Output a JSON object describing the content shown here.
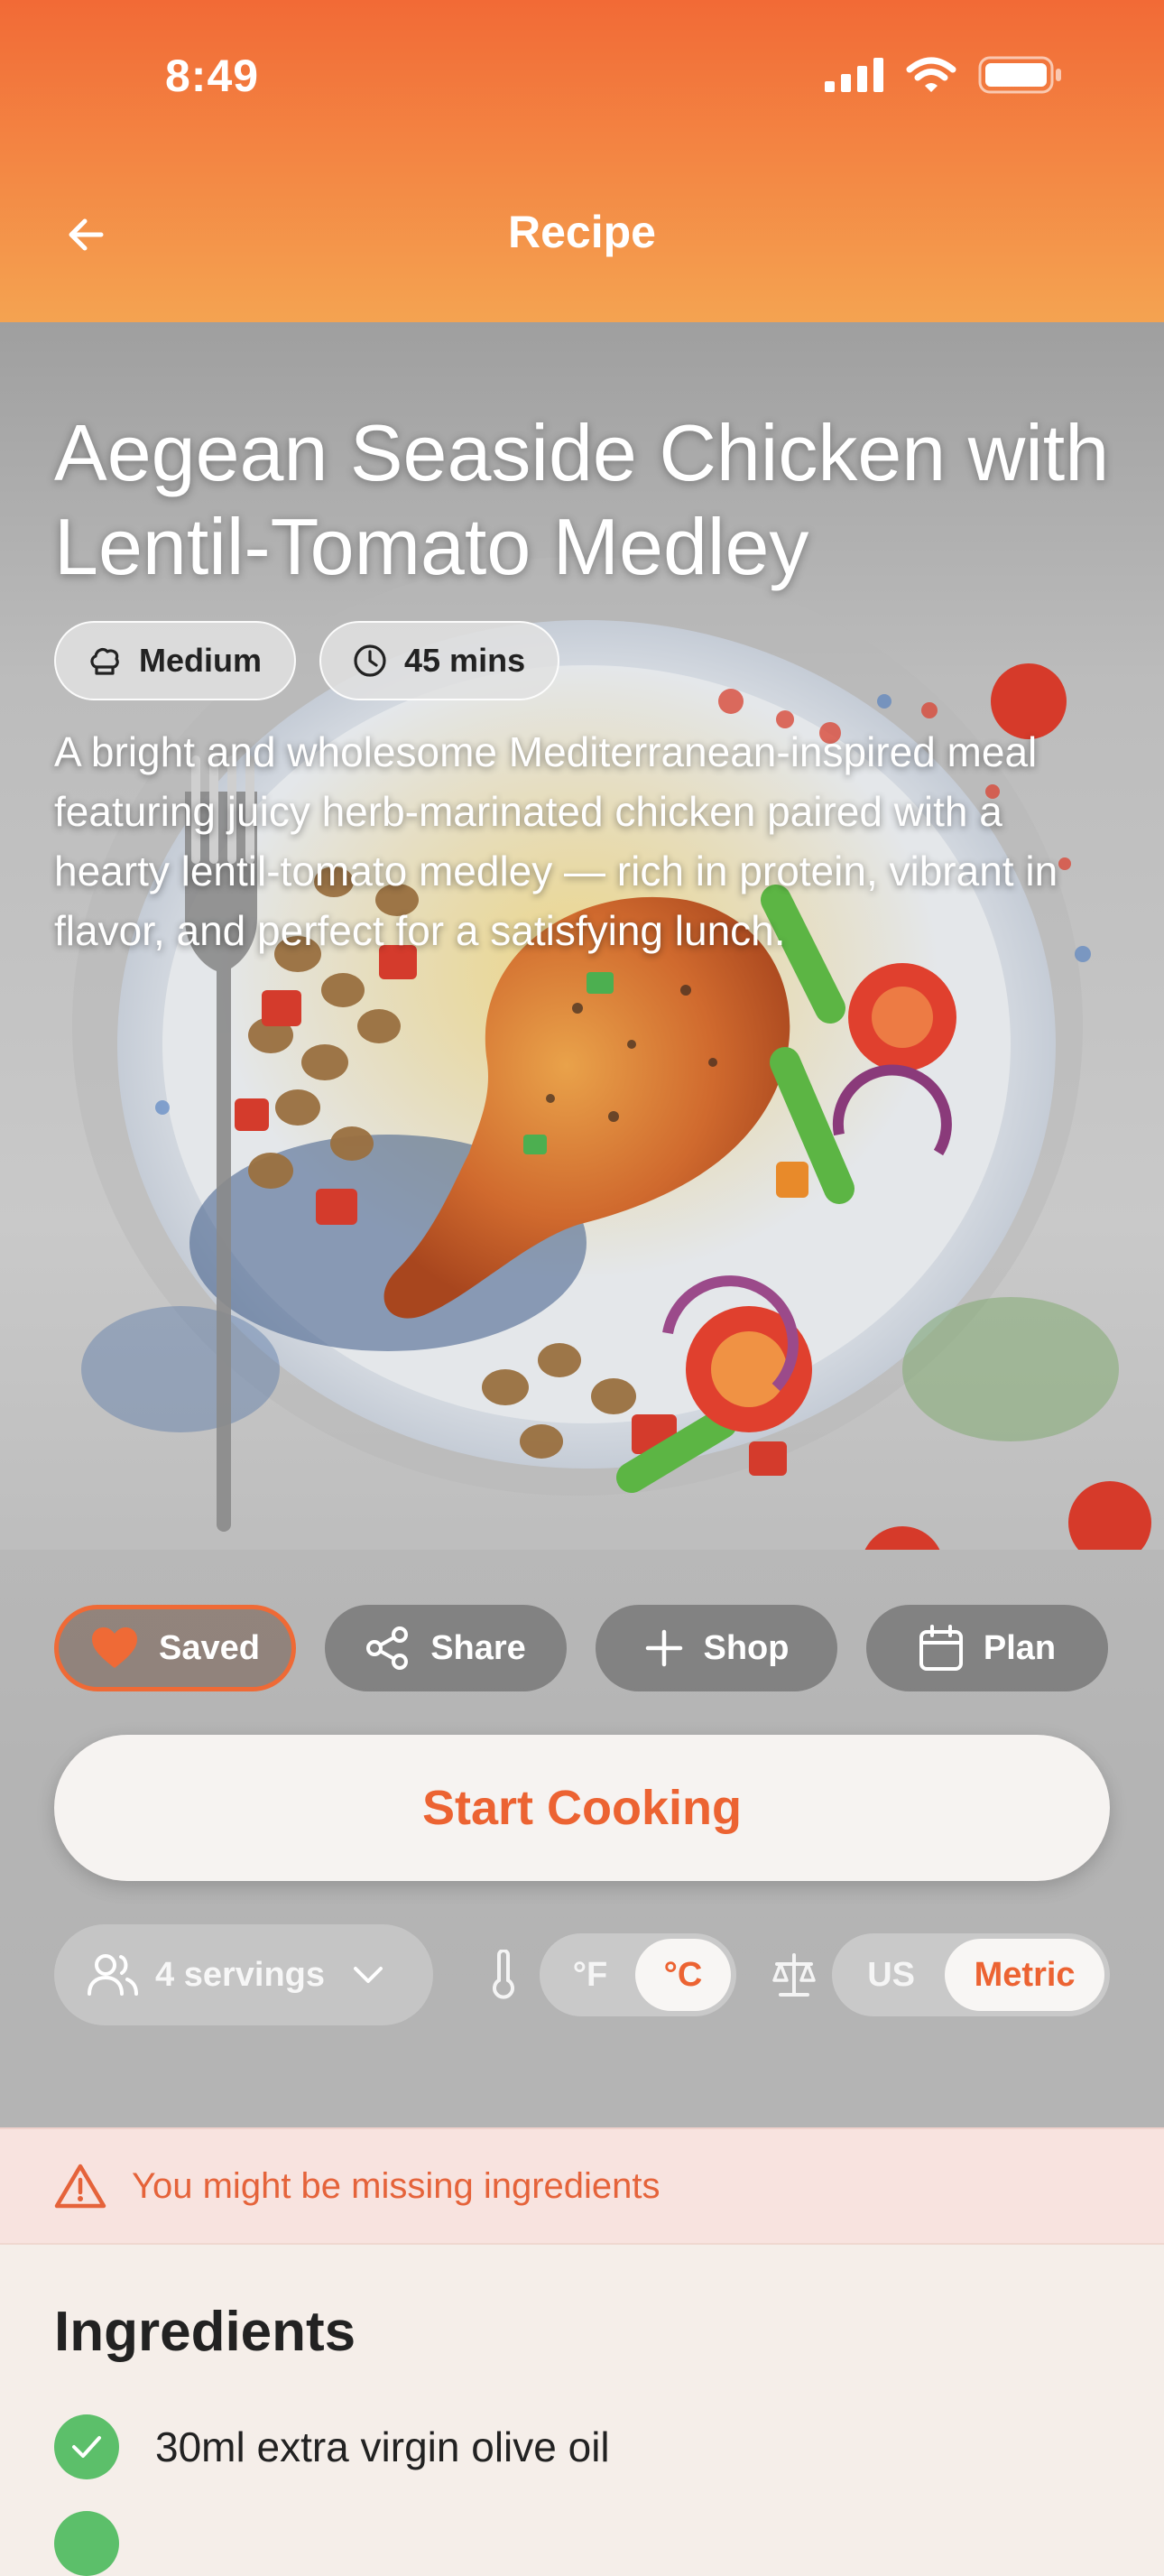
{
  "status_bar": {
    "time": "8:49"
  },
  "header": {
    "title": "Recipe",
    "back_icon": "arrow-left-icon"
  },
  "recipe": {
    "title": "Aegean Seaside Chicken with Lentil-Tomato Medley",
    "difficulty": "Medium",
    "duration": "45 mins",
    "description": "A bright and wholesome Mediterranean-inspired meal featuring juicy herb-marinated chicken paired with a hearty lentil-tomato medley — rich in protein, vibrant in flavor, and perfect for a satisfying lunch."
  },
  "actions": {
    "saved": "Saved",
    "share": "Share",
    "shop": "Shop",
    "plan": "Plan"
  },
  "start_button": "Start Cooking",
  "controls": {
    "servings": "4 servings",
    "temp_f": "°F",
    "temp_c": "°C",
    "temp_selected": "°C",
    "unit_us": "US",
    "unit_metric": "Metric",
    "unit_selected": "Metric"
  },
  "warning": "You might be missing ingredients",
  "ingredients": {
    "heading": "Ingredients",
    "items": [
      "30ml extra virgin olive oil"
    ]
  },
  "colors": {
    "accent": "#ec6332",
    "header_top": "#f26a36",
    "header_bottom": "#f4a351",
    "check_green": "#5cbf6a"
  }
}
